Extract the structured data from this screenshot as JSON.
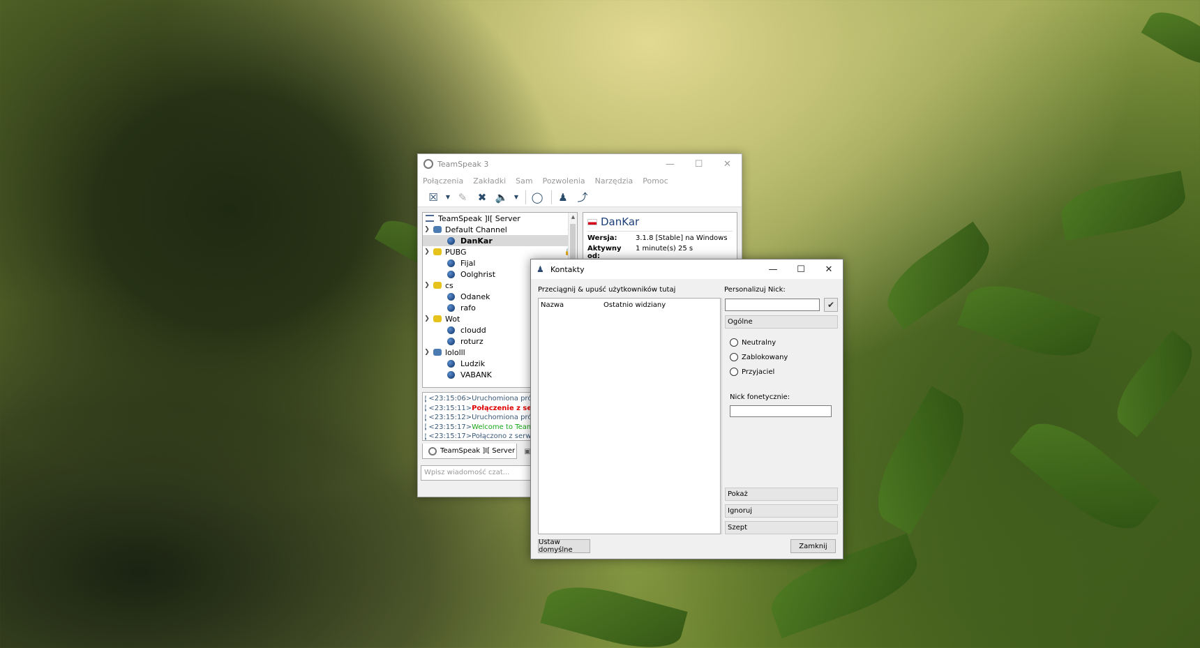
{
  "teamspeak": {
    "title": "TeamSpeak 3",
    "menu": [
      "Połączenia",
      "Zakładki",
      "Sam",
      "Pozwolenia",
      "Narzędzia",
      "Pomoc"
    ],
    "tree": {
      "server": "TeamSpeak ]I[ Server",
      "channels": [
        {
          "name": "Default Channel",
          "color": "#4b7bb0",
          "clients": [
            "DanKar"
          ]
        },
        {
          "name": "PUBG",
          "color": "#e7c21b",
          "clients": [
            "Fijal",
            "Oolghrist"
          ]
        },
        {
          "name": "cs",
          "color": "#e7c21b",
          "clients": [
            "Odanek",
            "rafo"
          ]
        },
        {
          "name": "Wot",
          "color": "#e7c21b",
          "clients": [
            "cloudd",
            "roturz"
          ]
        },
        {
          "name": "lololll",
          "color": "#4b7bb0",
          "clients": [
            "Ludzik",
            "VABANK"
          ]
        }
      ]
    },
    "info": {
      "name": "DanKar",
      "version_label": "Wersja:",
      "version_value": "3.1.8 [Stable] na Windows",
      "active_label": "Aktywny od:",
      "active_value": "1 minute(s) 25 s"
    },
    "log": [
      {
        "time": "<23:15:06>",
        "text": " Uruchomiona próba",
        "style": "normal"
      },
      {
        "time": "<23:15:11>",
        "text": " Połączenie z ser",
        "style": "red"
      },
      {
        "time": "<23:15:12>",
        "text": " Uruchomiona próba",
        "style": "normal"
      },
      {
        "time": "<23:15:17>",
        "text": " Welcome to TeamS",
        "style": "green"
      },
      {
        "time": "<23:15:17>",
        "text": " Połączono z serwer",
        "style": "normal"
      }
    ],
    "tab_label": "TeamSpeak ]I[ Server",
    "chat_placeholder": "Wpisz wiadomość czat..."
  },
  "contacts_dialog": {
    "title": "Kontakty",
    "drag_hint": "Przeciągnij & upuść użytkowników tutaj",
    "columns": [
      "Nazwa",
      "Ostatnio widziany"
    ],
    "personalize_label": "Personalizuj Nick:",
    "general_section": "Ogólne",
    "radio_options": [
      "Neutralny",
      "Zablokowany",
      "Przyjaciel"
    ],
    "phonetic_label": "Nick fonetycznie:",
    "side_buttons": [
      "Pokaż",
      "Ignoruj",
      "Szept"
    ],
    "reset_button": "Ustaw domyślne",
    "close_button": "Zamknij"
  }
}
